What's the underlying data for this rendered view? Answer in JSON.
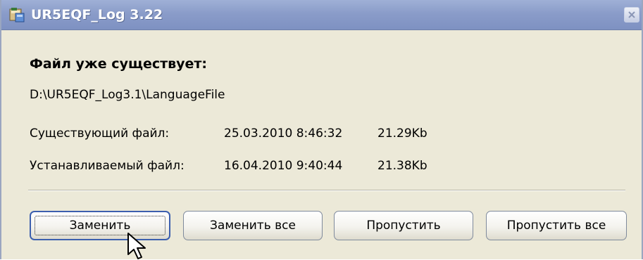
{
  "window": {
    "title": "UR5EQF_Log 3.22"
  },
  "dialog": {
    "heading": "Файл уже существует:",
    "path": "D:\\UR5EQF_Log3.1\\LanguageFile",
    "existing": {
      "label": "Существующий файл:",
      "date": "25.03.2010 8:46:32",
      "size": "21.29Kb"
    },
    "installing": {
      "label": "Устанавливаемый файл:",
      "date": "16.04.2010 9:40:44",
      "size": "21.38Kb"
    }
  },
  "buttons": {
    "replace": "Заменить",
    "replace_all": "Заменить все",
    "skip": "Пропустить",
    "skip_all": "Пропустить все"
  },
  "icons": {
    "app": "installer-icon",
    "close": "close-icon",
    "cursor": "arrow-cursor-icon"
  }
}
